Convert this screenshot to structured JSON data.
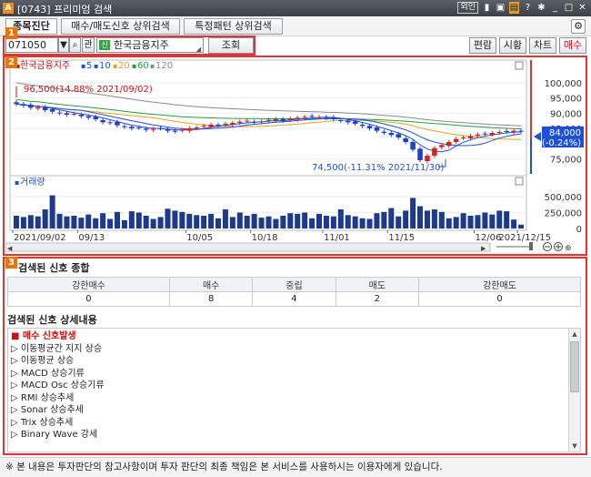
{
  "window": {
    "app_icon": "A",
    "title": "[0743] 프리미엄 검색",
    "lang_button": "외인",
    "icons": [
      "pin-icon",
      "window-icon",
      "display-icon",
      "help-icon",
      "settings-icon",
      "minimize-icon",
      "restore-icon",
      "close-icon"
    ]
  },
  "tabs": [
    {
      "label": "종목진단"
    },
    {
      "label": "매수/매도신호 상위검색"
    },
    {
      "label": "특정패턴 상위검색"
    }
  ],
  "badges": [
    "1",
    "2",
    "3"
  ],
  "toolbar": {
    "code_value": "071050",
    "kwan_label": "관",
    "sin_label": "신",
    "stock_name": "한국금융지주",
    "query_button": "조회",
    "right_buttons": [
      "편람",
      "시황",
      "차트",
      "매수"
    ]
  },
  "chart_data": {
    "type": "candlestick",
    "legend": {
      "symbol": "한국금융지주",
      "ma": [
        {
          "label": "5",
          "color": "#1e4fd8"
        },
        {
          "label": "10",
          "color": "#1e4fd8"
        },
        {
          "label": "20",
          "color": "#e8a020"
        },
        {
          "label": "60",
          "color": "#22a040"
        },
        {
          "label": "120",
          "color": "#8a8a8a"
        }
      ]
    },
    "price_axis": {
      "ticks": [
        "100,000",
        "95,000",
        "90,000",
        "85,000",
        "75,000"
      ],
      "ylim": [
        70000,
        103000
      ]
    },
    "current_price": {
      "value": "84,000",
      "change": "(-0.24%)"
    },
    "annotations": {
      "high": "96,500(14.88% 2021/09/02)",
      "low": "74,500(-11.31% 2021/11/30)"
    },
    "volume_label": "거래량",
    "volume_axis": {
      "ticks": [
        "500,000",
        "250,000",
        "0"
      ],
      "ylim": [
        0,
        600000
      ]
    },
    "dates": [
      "2021/09/02",
      "09/13",
      "10/05",
      "10/18",
      "11/01",
      "11/15",
      "12/06",
      "2021/12/15"
    ],
    "close": [
      93000,
      92500,
      91800,
      92000,
      91000,
      90500,
      90000,
      89500,
      89800,
      89000,
      88500,
      88000,
      87000,
      86800,
      86000,
      85500,
      85000,
      85200,
      84500,
      84800,
      85000,
      84200,
      84000,
      84500,
      85000,
      85300,
      85800,
      86200,
      86000,
      86500,
      86800,
      87200,
      87500,
      87000,
      87300,
      87800,
      88000,
      87500,
      88200,
      88500,
      88800,
      89000,
      88700,
      88400,
      88000,
      87500,
      87000,
      86500,
      85800,
      85000,
      84200,
      83500,
      82800,
      82000,
      80500,
      78000,
      74500,
      76000,
      78500,
      79500,
      80500,
      81500,
      82000,
      82500,
      83000,
      83200,
      83500,
      83800,
      84000,
      84200,
      84000
    ],
    "volume": [
      200000,
      180000,
      210000,
      190000,
      300000,
      520000,
      230000,
      190000,
      200000,
      170000,
      220000,
      160000,
      240000,
      150000,
      260000,
      130000,
      270000,
      250000,
      200000,
      150000,
      180000,
      310000,
      280000,
      260000,
      230000,
      210000,
      200000,
      230000,
      160000,
      300000,
      180000,
      250000,
      200000,
      230000,
      170000,
      190000,
      150000,
      200000,
      240000,
      230000,
      250000,
      160000,
      230000,
      200000,
      190000,
      300000,
      210000,
      190000,
      160000,
      150000,
      240000,
      260000,
      320000,
      190000,
      280000,
      480000,
      350000,
      280000,
      300000,
      260000,
      160000,
      180000,
      240000,
      200000,
      210000,
      250000,
      220000,
      280000,
      270000,
      140000,
      60000
    ]
  },
  "summary": {
    "title": "검색된 신호 종합",
    "headers": [
      "강한매수",
      "매수",
      "중립",
      "매도",
      "강한매도"
    ],
    "values": [
      "0",
      "8",
      "4",
      "2",
      "0"
    ]
  },
  "detail": {
    "title": "검색된 신호 상세내용",
    "items": [
      {
        "text": "■ 매수 신호발생",
        "head": true
      },
      {
        "text": "▷ 이동평균간 지지 상승"
      },
      {
        "text": "▷ 이동평균 상승"
      },
      {
        "text": "▷ MACD 상승기류"
      },
      {
        "text": "▷ MACD Osc 상승기류"
      },
      {
        "text": "▷ RMI 상승추세"
      },
      {
        "text": "▷ Sonar 상승추세"
      },
      {
        "text": "▷ Trix 상승추세"
      },
      {
        "text": "▷ Binary Wave 강세"
      }
    ]
  },
  "notice": "※ 본 내용은 투자판단의 참고사항이며 투자 판단의 최종 책임은 본 서비스를 사용하시는 이용자에게 있습니다."
}
